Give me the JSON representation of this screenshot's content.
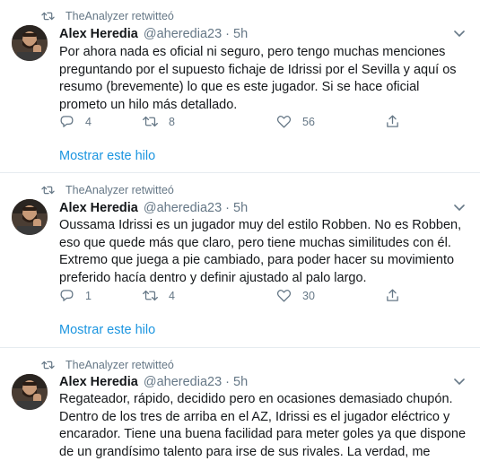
{
  "tweets": [
    {
      "retweeter": "TheAnalyzer retwitteó",
      "name": "Alex Heredia",
      "handle": "@aheredia23",
      "dot": "·",
      "time": "5h",
      "text": "Por ahora nada es oficial ni seguro, pero tengo muchas menciones preguntando por el supuesto fichaje de Idrissi por el Sevilla y aquí os resumo (brevemente) lo que es este jugador. Si se hace oficial prometo un hilo más detallado.",
      "replies": "4",
      "retweets": "8",
      "likes": "56",
      "show_thread": "Mostrar este hilo"
    },
    {
      "retweeter": "TheAnalyzer retwitteó",
      "name": "Alex Heredia",
      "handle": "@aheredia23",
      "dot": "·",
      "time": "5h",
      "text": "Oussama Idrissi es un jugador muy del estilo Robben. No es Robben, eso que quede más que claro, pero tiene muchas similitudes con él. Extremo que juega a pie cambiado, para poder hacer su movimiento preferido hacía dentro y definir ajustado al palo largo.",
      "replies": "1",
      "retweets": "4",
      "likes": "30",
      "show_thread": "Mostrar este hilo"
    },
    {
      "retweeter": "TheAnalyzer retwitteó",
      "name": "Alex Heredia",
      "handle": "@aheredia23",
      "dot": "·",
      "time": "5h",
      "text": "Regateador, rápido, decidido pero en ocasiones demasiado chupón. Dentro de los tres de arriba en el AZ, Idrissi es el jugador eléctrico y encarador. Tiene una buena facilidad para meter goles ya que dispone de un grandísimo talento para irse de sus rivales. La verdad, me encanta."
    }
  ],
  "colors": {
    "link": "#1b95e0",
    "secondary": "#657786",
    "text": "#14171a",
    "divider": "#e6ecf0"
  },
  "icons": [
    "retweet-icon",
    "chevron-down-icon",
    "reply-icon",
    "retweet-icon",
    "like-icon",
    "share-icon"
  ]
}
